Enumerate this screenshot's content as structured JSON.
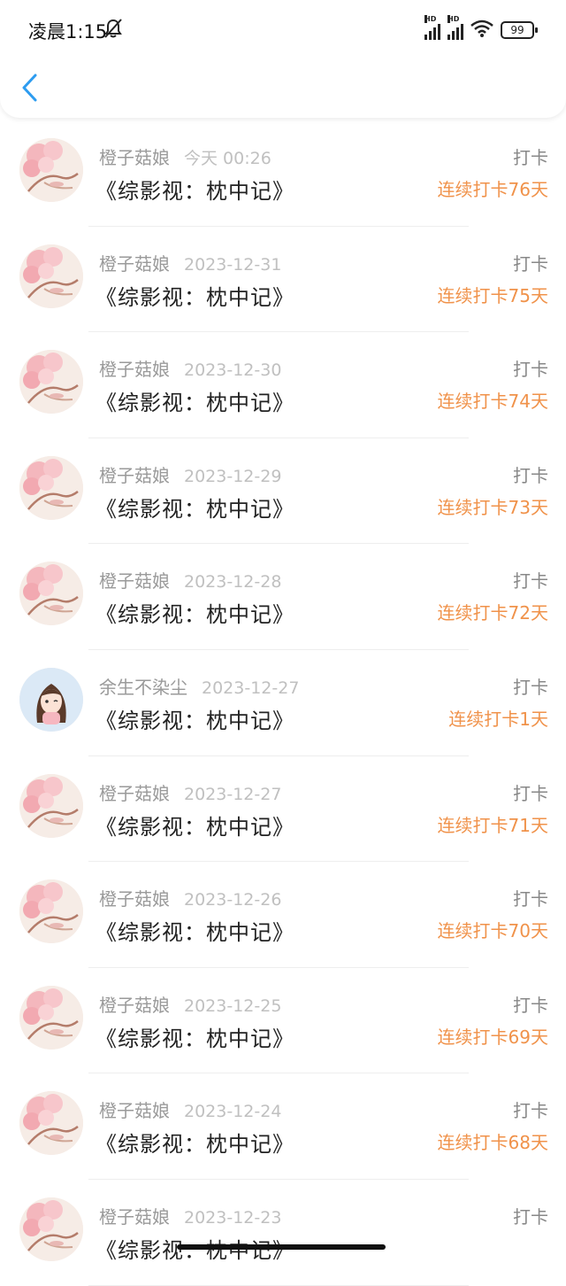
{
  "status_bar": {
    "time": "凌晨1:15",
    "hd1": "HD",
    "hd2": "HD",
    "battery": "99"
  },
  "colors": {
    "accent_back": "#2d9cf0",
    "streak": "#f0924a",
    "meta_gray": "#9a9a9a"
  },
  "entries": [
    {
      "user": "橙子菇娘",
      "date": "今天 00:26",
      "title": "《综影视：枕中记》",
      "action": "打卡",
      "streak": "连续打卡76天",
      "avatar": "cherry-blossom-avatar"
    },
    {
      "user": "橙子菇娘",
      "date": "2023-12-31",
      "title": "《综影视：枕中记》",
      "action": "打卡",
      "streak": "连续打卡75天",
      "avatar": "cherry-blossom-avatar"
    },
    {
      "user": "橙子菇娘",
      "date": "2023-12-30",
      "title": "《综影视：枕中记》",
      "action": "打卡",
      "streak": "连续打卡74天",
      "avatar": "cherry-blossom-avatar"
    },
    {
      "user": "橙子菇娘",
      "date": "2023-12-29",
      "title": "《综影视：枕中记》",
      "action": "打卡",
      "streak": "连续打卡73天",
      "avatar": "cherry-blossom-avatar"
    },
    {
      "user": "橙子菇娘",
      "date": "2023-12-28",
      "title": "《综影视：枕中记》",
      "action": "打卡",
      "streak": "连续打卡72天",
      "avatar": "cherry-blossom-avatar"
    },
    {
      "user": "余生不染尘",
      "date": "2023-12-27",
      "title": "《综影视：枕中记》",
      "action": "打卡",
      "streak": "连续打卡1天",
      "avatar": "girl-avatar"
    },
    {
      "user": "橙子菇娘",
      "date": "2023-12-27",
      "title": "《综影视：枕中记》",
      "action": "打卡",
      "streak": "连续打卡71天",
      "avatar": "cherry-blossom-avatar"
    },
    {
      "user": "橙子菇娘",
      "date": "2023-12-26",
      "title": "《综影视：枕中记》",
      "action": "打卡",
      "streak": "连续打卡70天",
      "avatar": "cherry-blossom-avatar"
    },
    {
      "user": "橙子菇娘",
      "date": "2023-12-25",
      "title": "《综影视：枕中记》",
      "action": "打卡",
      "streak": "连续打卡69天",
      "avatar": "cherry-blossom-avatar"
    },
    {
      "user": "橙子菇娘",
      "date": "2023-12-24",
      "title": "《综影视：枕中记》",
      "action": "打卡",
      "streak": "连续打卡68天",
      "avatar": "cherry-blossom-avatar"
    },
    {
      "user": "橙子菇娘",
      "date": "2023-12-23",
      "title": "《综影视：枕中记》",
      "action": "打卡",
      "streak": "",
      "avatar": "cherry-blossom-avatar"
    }
  ]
}
